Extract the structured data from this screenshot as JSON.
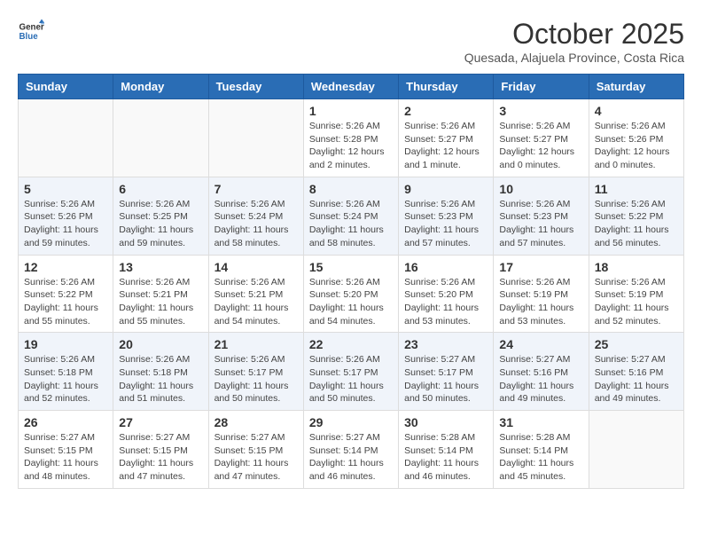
{
  "header": {
    "logo_line1": "General",
    "logo_line2": "Blue",
    "month": "October 2025",
    "location": "Quesada, Alajuela Province, Costa Rica"
  },
  "weekdays": [
    "Sunday",
    "Monday",
    "Tuesday",
    "Wednesday",
    "Thursday",
    "Friday",
    "Saturday"
  ],
  "weeks": [
    [
      {
        "day": "",
        "info": ""
      },
      {
        "day": "",
        "info": ""
      },
      {
        "day": "",
        "info": ""
      },
      {
        "day": "1",
        "info": "Sunrise: 5:26 AM\nSunset: 5:28 PM\nDaylight: 12 hours\nand 2 minutes."
      },
      {
        "day": "2",
        "info": "Sunrise: 5:26 AM\nSunset: 5:27 PM\nDaylight: 12 hours\nand 1 minute."
      },
      {
        "day": "3",
        "info": "Sunrise: 5:26 AM\nSunset: 5:27 PM\nDaylight: 12 hours\nand 0 minutes."
      },
      {
        "day": "4",
        "info": "Sunrise: 5:26 AM\nSunset: 5:26 PM\nDaylight: 12 hours\nand 0 minutes."
      }
    ],
    [
      {
        "day": "5",
        "info": "Sunrise: 5:26 AM\nSunset: 5:26 PM\nDaylight: 11 hours\nand 59 minutes."
      },
      {
        "day": "6",
        "info": "Sunrise: 5:26 AM\nSunset: 5:25 PM\nDaylight: 11 hours\nand 59 minutes."
      },
      {
        "day": "7",
        "info": "Sunrise: 5:26 AM\nSunset: 5:24 PM\nDaylight: 11 hours\nand 58 minutes."
      },
      {
        "day": "8",
        "info": "Sunrise: 5:26 AM\nSunset: 5:24 PM\nDaylight: 11 hours\nand 58 minutes."
      },
      {
        "day": "9",
        "info": "Sunrise: 5:26 AM\nSunset: 5:23 PM\nDaylight: 11 hours\nand 57 minutes."
      },
      {
        "day": "10",
        "info": "Sunrise: 5:26 AM\nSunset: 5:23 PM\nDaylight: 11 hours\nand 57 minutes."
      },
      {
        "day": "11",
        "info": "Sunrise: 5:26 AM\nSunset: 5:22 PM\nDaylight: 11 hours\nand 56 minutes."
      }
    ],
    [
      {
        "day": "12",
        "info": "Sunrise: 5:26 AM\nSunset: 5:22 PM\nDaylight: 11 hours\nand 55 minutes."
      },
      {
        "day": "13",
        "info": "Sunrise: 5:26 AM\nSunset: 5:21 PM\nDaylight: 11 hours\nand 55 minutes."
      },
      {
        "day": "14",
        "info": "Sunrise: 5:26 AM\nSunset: 5:21 PM\nDaylight: 11 hours\nand 54 minutes."
      },
      {
        "day": "15",
        "info": "Sunrise: 5:26 AM\nSunset: 5:20 PM\nDaylight: 11 hours\nand 54 minutes."
      },
      {
        "day": "16",
        "info": "Sunrise: 5:26 AM\nSunset: 5:20 PM\nDaylight: 11 hours\nand 53 minutes."
      },
      {
        "day": "17",
        "info": "Sunrise: 5:26 AM\nSunset: 5:19 PM\nDaylight: 11 hours\nand 53 minutes."
      },
      {
        "day": "18",
        "info": "Sunrise: 5:26 AM\nSunset: 5:19 PM\nDaylight: 11 hours\nand 52 minutes."
      }
    ],
    [
      {
        "day": "19",
        "info": "Sunrise: 5:26 AM\nSunset: 5:18 PM\nDaylight: 11 hours\nand 52 minutes."
      },
      {
        "day": "20",
        "info": "Sunrise: 5:26 AM\nSunset: 5:18 PM\nDaylight: 11 hours\nand 51 minutes."
      },
      {
        "day": "21",
        "info": "Sunrise: 5:26 AM\nSunset: 5:17 PM\nDaylight: 11 hours\nand 50 minutes."
      },
      {
        "day": "22",
        "info": "Sunrise: 5:26 AM\nSunset: 5:17 PM\nDaylight: 11 hours\nand 50 minutes."
      },
      {
        "day": "23",
        "info": "Sunrise: 5:27 AM\nSunset: 5:17 PM\nDaylight: 11 hours\nand 50 minutes."
      },
      {
        "day": "24",
        "info": "Sunrise: 5:27 AM\nSunset: 5:16 PM\nDaylight: 11 hours\nand 49 minutes."
      },
      {
        "day": "25",
        "info": "Sunrise: 5:27 AM\nSunset: 5:16 PM\nDaylight: 11 hours\nand 49 minutes."
      }
    ],
    [
      {
        "day": "26",
        "info": "Sunrise: 5:27 AM\nSunset: 5:15 PM\nDaylight: 11 hours\nand 48 minutes."
      },
      {
        "day": "27",
        "info": "Sunrise: 5:27 AM\nSunset: 5:15 PM\nDaylight: 11 hours\nand 47 minutes."
      },
      {
        "day": "28",
        "info": "Sunrise: 5:27 AM\nSunset: 5:15 PM\nDaylight: 11 hours\nand 47 minutes."
      },
      {
        "day": "29",
        "info": "Sunrise: 5:27 AM\nSunset: 5:14 PM\nDaylight: 11 hours\nand 46 minutes."
      },
      {
        "day": "30",
        "info": "Sunrise: 5:28 AM\nSunset: 5:14 PM\nDaylight: 11 hours\nand 46 minutes."
      },
      {
        "day": "31",
        "info": "Sunrise: 5:28 AM\nSunset: 5:14 PM\nDaylight: 11 hours\nand 45 minutes."
      },
      {
        "day": "",
        "info": ""
      }
    ]
  ]
}
